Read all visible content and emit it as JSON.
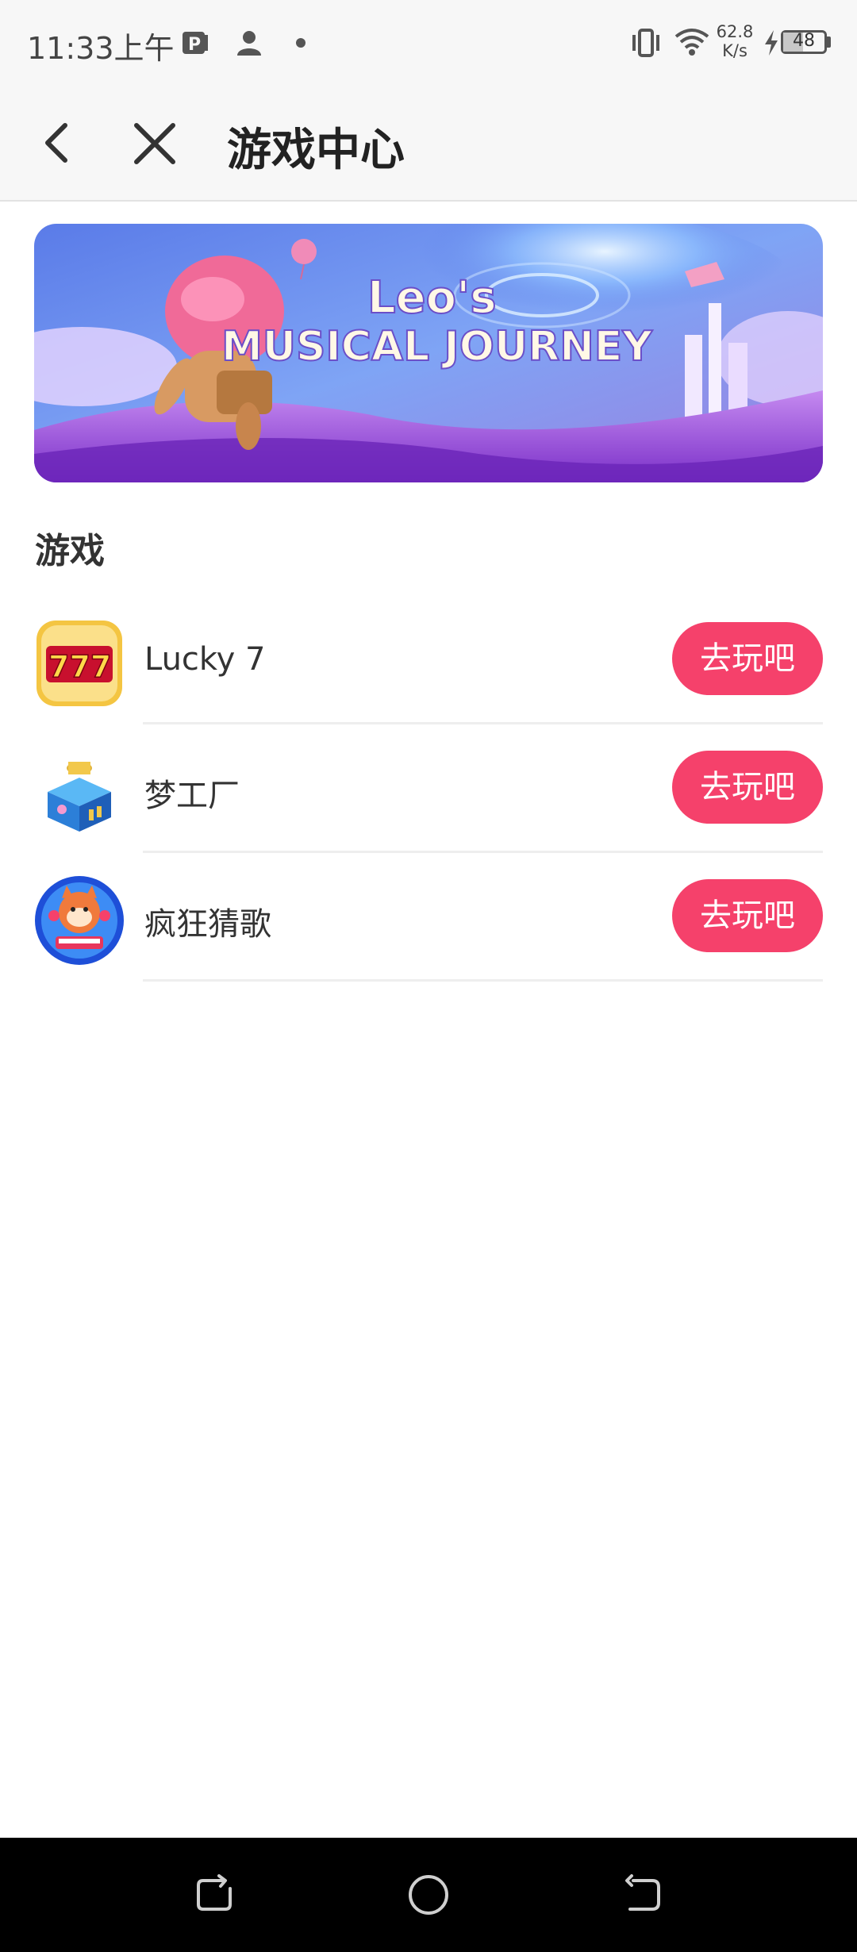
{
  "status_bar": {
    "time": "11:33上午",
    "speed_value": "62.8",
    "speed_unit": "K/s",
    "battery_level": "48",
    "icons": [
      "p-app-icon",
      "person-icon",
      "notification-dot",
      "vibrate-icon",
      "wifi-icon",
      "charging-icon",
      "battery-icon"
    ]
  },
  "title_bar": {
    "title": "游戏中心",
    "icons": [
      "back-arrow-icon",
      "close-icon"
    ]
  },
  "banner": {
    "line1": "Leo's",
    "line2": "MUSICAL JOURNEY"
  },
  "section": {
    "title": "游戏"
  },
  "games": [
    {
      "name": "Lucky 7",
      "button": "去玩吧",
      "icon": "slot-777-icon"
    },
    {
      "name": "梦工厂",
      "button": "去玩吧",
      "icon": "blue-cube-icon"
    },
    {
      "name": "疯狂猜歌",
      "button": "去玩吧",
      "icon": "music-cat-icon"
    }
  ],
  "nav_bar": {
    "icons": [
      "recent-apps-icon",
      "home-icon",
      "back-icon"
    ]
  },
  "colors": {
    "accent": "#f5416b",
    "header_bg": "#f7f7f7",
    "nav_bg": "#000000"
  }
}
